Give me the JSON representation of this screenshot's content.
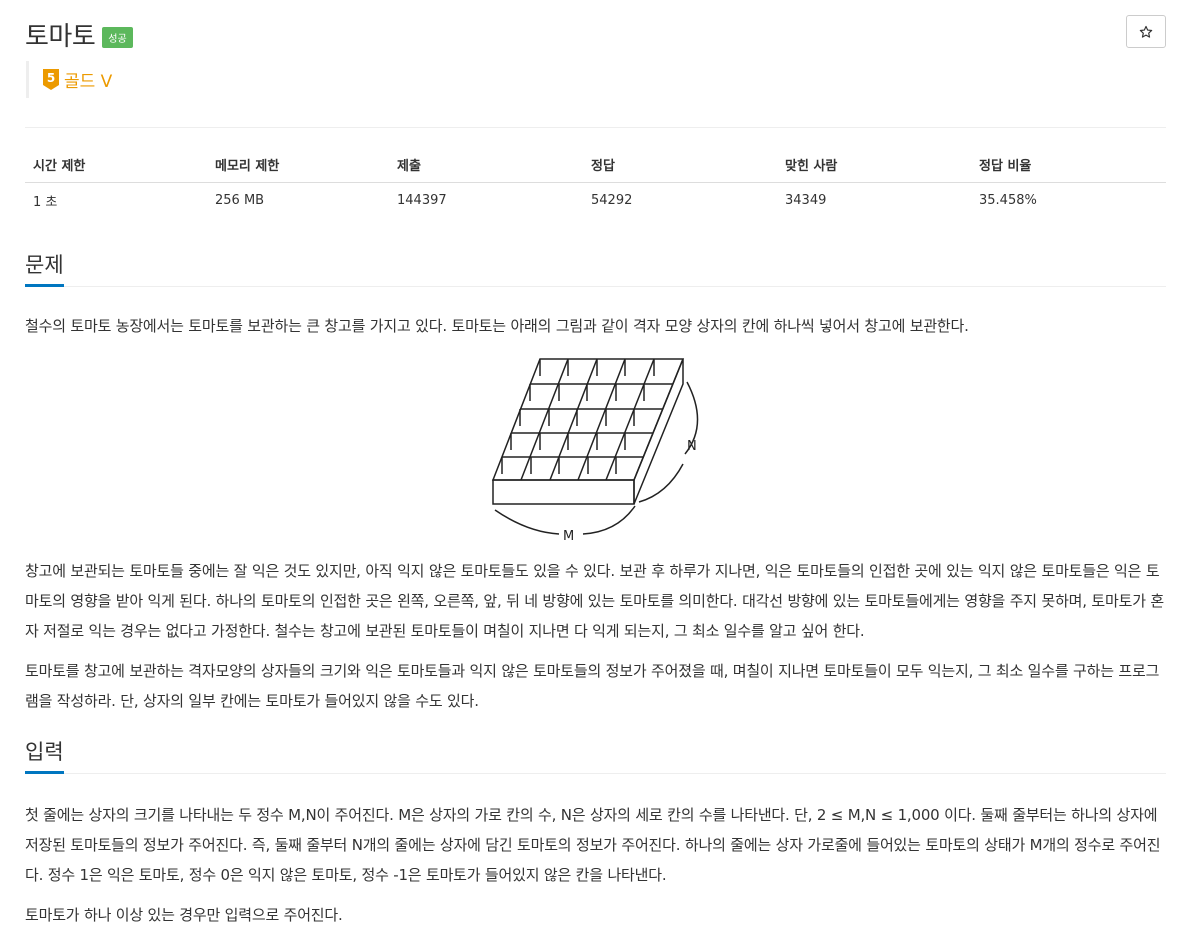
{
  "problem": {
    "title": "토마토",
    "status_badge": "성공",
    "tier": {
      "number": "5",
      "label": "골드 V",
      "color": "#ec9a00"
    },
    "star_icon": "star-outline-icon"
  },
  "stats": {
    "headers": [
      "시간 제한",
      "메모리 제한",
      "제출",
      "정답",
      "맞힌 사람",
      "정답 비율"
    ],
    "values": [
      "1 초",
      "256 MB",
      "144397",
      "54292",
      "34349",
      "35.458%"
    ]
  },
  "sections": {
    "problem_heading": "문제",
    "problem_para1": "철수의 토마토 농장에서는 토마토를 보관하는 큰 창고를 가지고 있다. 토마토는 아래의 그림과 같이 격자 모양 상자의 칸에 하나씩 넣어서 창고에 보관한다.",
    "figure_label_n": "N",
    "figure_label_m": "M",
    "problem_para2": "창고에 보관되는 토마토들 중에는 잘 익은 것도 있지만, 아직 익지 않은 토마토들도 있을 수 있다. 보관 후 하루가 지나면, 익은 토마토들의 인접한 곳에 있는 익지 않은 토마토들은 익은 토마토의 영향을 받아 익게 된다. 하나의 토마토의 인접한 곳은 왼쪽, 오른쪽, 앞, 뒤 네 방향에 있는 토마토를 의미한다. 대각선 방향에 있는 토마토들에게는 영향을 주지 못하며, 토마토가 혼자 저절로 익는 경우는 없다고 가정한다. 철수는 창고에 보관된 토마토들이 며칠이 지나면 다 익게 되는지, 그 최소 일수를 알고 싶어 한다.",
    "problem_para3": "토마토를 창고에 보관하는 격자모양의 상자들의 크기와 익은 토마토들과 익지 않은 토마토들의 정보가 주어졌을 때, 며칠이 지나면 토마토들이 모두 익는지, 그 최소 일수를 구하는 프로그램을 작성하라. 단, 상자의 일부 칸에는 토마토가 들어있지 않을 수도 있다.",
    "input_heading": "입력",
    "input_para1": "첫 줄에는 상자의 크기를 나타내는 두 정수 M,N이 주어진다. M은 상자의 가로 칸의 수, N은 상자의 세로 칸의 수를 나타낸다. 단, 2 ≤ M,N ≤ 1,000 이다. 둘째 줄부터는 하나의 상자에 저장된 토마토들의 정보가 주어진다. 즉, 둘째 줄부터 N개의 줄에는 상자에 담긴 토마토의 정보가 주어진다. 하나의 줄에는 상자 가로줄에 들어있는 토마토의 상태가 M개의 정수로 주어진다. 정수 1은 익은 토마토, 정수 0은 익지 않은 토마토, 정수 -1은 토마토가 들어있지 않은 칸을 나타낸다.",
    "input_para2": "토마토가 하나 이상 있는 경우만 입력으로 주어진다."
  }
}
